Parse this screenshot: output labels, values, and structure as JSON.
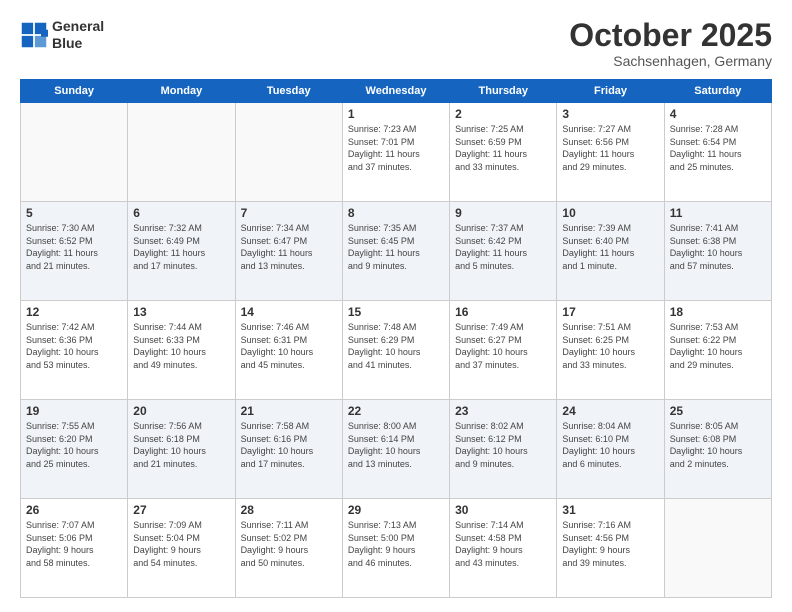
{
  "header": {
    "logo_line1": "General",
    "logo_line2": "Blue",
    "month": "October 2025",
    "location": "Sachsenhagen, Germany"
  },
  "weekdays": [
    "Sunday",
    "Monday",
    "Tuesday",
    "Wednesday",
    "Thursday",
    "Friday",
    "Saturday"
  ],
  "weeks": [
    [
      {
        "day": "",
        "info": ""
      },
      {
        "day": "",
        "info": ""
      },
      {
        "day": "",
        "info": ""
      },
      {
        "day": "1",
        "info": "Sunrise: 7:23 AM\nSunset: 7:01 PM\nDaylight: 11 hours\nand 37 minutes."
      },
      {
        "day": "2",
        "info": "Sunrise: 7:25 AM\nSunset: 6:59 PM\nDaylight: 11 hours\nand 33 minutes."
      },
      {
        "day": "3",
        "info": "Sunrise: 7:27 AM\nSunset: 6:56 PM\nDaylight: 11 hours\nand 29 minutes."
      },
      {
        "day": "4",
        "info": "Sunrise: 7:28 AM\nSunset: 6:54 PM\nDaylight: 11 hours\nand 25 minutes."
      }
    ],
    [
      {
        "day": "5",
        "info": "Sunrise: 7:30 AM\nSunset: 6:52 PM\nDaylight: 11 hours\nand 21 minutes."
      },
      {
        "day": "6",
        "info": "Sunrise: 7:32 AM\nSunset: 6:49 PM\nDaylight: 11 hours\nand 17 minutes."
      },
      {
        "day": "7",
        "info": "Sunrise: 7:34 AM\nSunset: 6:47 PM\nDaylight: 11 hours\nand 13 minutes."
      },
      {
        "day": "8",
        "info": "Sunrise: 7:35 AM\nSunset: 6:45 PM\nDaylight: 11 hours\nand 9 minutes."
      },
      {
        "day": "9",
        "info": "Sunrise: 7:37 AM\nSunset: 6:42 PM\nDaylight: 11 hours\nand 5 minutes."
      },
      {
        "day": "10",
        "info": "Sunrise: 7:39 AM\nSunset: 6:40 PM\nDaylight: 11 hours\nand 1 minute."
      },
      {
        "day": "11",
        "info": "Sunrise: 7:41 AM\nSunset: 6:38 PM\nDaylight: 10 hours\nand 57 minutes."
      }
    ],
    [
      {
        "day": "12",
        "info": "Sunrise: 7:42 AM\nSunset: 6:36 PM\nDaylight: 10 hours\nand 53 minutes."
      },
      {
        "day": "13",
        "info": "Sunrise: 7:44 AM\nSunset: 6:33 PM\nDaylight: 10 hours\nand 49 minutes."
      },
      {
        "day": "14",
        "info": "Sunrise: 7:46 AM\nSunset: 6:31 PM\nDaylight: 10 hours\nand 45 minutes."
      },
      {
        "day": "15",
        "info": "Sunrise: 7:48 AM\nSunset: 6:29 PM\nDaylight: 10 hours\nand 41 minutes."
      },
      {
        "day": "16",
        "info": "Sunrise: 7:49 AM\nSunset: 6:27 PM\nDaylight: 10 hours\nand 37 minutes."
      },
      {
        "day": "17",
        "info": "Sunrise: 7:51 AM\nSunset: 6:25 PM\nDaylight: 10 hours\nand 33 minutes."
      },
      {
        "day": "18",
        "info": "Sunrise: 7:53 AM\nSunset: 6:22 PM\nDaylight: 10 hours\nand 29 minutes."
      }
    ],
    [
      {
        "day": "19",
        "info": "Sunrise: 7:55 AM\nSunset: 6:20 PM\nDaylight: 10 hours\nand 25 minutes."
      },
      {
        "day": "20",
        "info": "Sunrise: 7:56 AM\nSunset: 6:18 PM\nDaylight: 10 hours\nand 21 minutes."
      },
      {
        "day": "21",
        "info": "Sunrise: 7:58 AM\nSunset: 6:16 PM\nDaylight: 10 hours\nand 17 minutes."
      },
      {
        "day": "22",
        "info": "Sunrise: 8:00 AM\nSunset: 6:14 PM\nDaylight: 10 hours\nand 13 minutes."
      },
      {
        "day": "23",
        "info": "Sunrise: 8:02 AM\nSunset: 6:12 PM\nDaylight: 10 hours\nand 9 minutes."
      },
      {
        "day": "24",
        "info": "Sunrise: 8:04 AM\nSunset: 6:10 PM\nDaylight: 10 hours\nand 6 minutes."
      },
      {
        "day": "25",
        "info": "Sunrise: 8:05 AM\nSunset: 6:08 PM\nDaylight: 10 hours\nand 2 minutes."
      }
    ],
    [
      {
        "day": "26",
        "info": "Sunrise: 7:07 AM\nSunset: 5:06 PM\nDaylight: 9 hours\nand 58 minutes."
      },
      {
        "day": "27",
        "info": "Sunrise: 7:09 AM\nSunset: 5:04 PM\nDaylight: 9 hours\nand 54 minutes."
      },
      {
        "day": "28",
        "info": "Sunrise: 7:11 AM\nSunset: 5:02 PM\nDaylight: 9 hours\nand 50 minutes."
      },
      {
        "day": "29",
        "info": "Sunrise: 7:13 AM\nSunset: 5:00 PM\nDaylight: 9 hours\nand 46 minutes."
      },
      {
        "day": "30",
        "info": "Sunrise: 7:14 AM\nSunset: 4:58 PM\nDaylight: 9 hours\nand 43 minutes."
      },
      {
        "day": "31",
        "info": "Sunrise: 7:16 AM\nSunset: 4:56 PM\nDaylight: 9 hours\nand 39 minutes."
      },
      {
        "day": "",
        "info": ""
      }
    ]
  ]
}
